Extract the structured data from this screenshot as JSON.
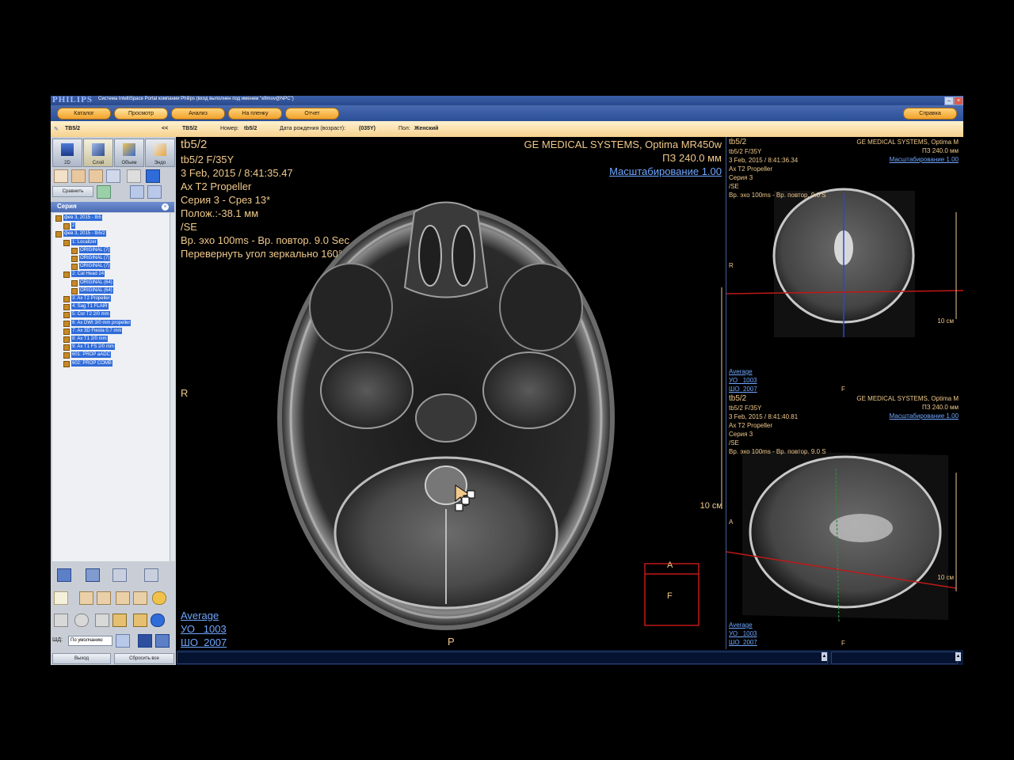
{
  "window": {
    "brand": "PHILIPS",
    "title": "Система IntelliSpace Portal компании Philips (вход выполнен под именем \"efimov@NPC\")",
    "help_label": "Справка"
  },
  "menu": [
    "Каталог",
    "Просмотр",
    "Анализ",
    "На пленку",
    "Отчет"
  ],
  "infobar": {
    "study_label": "TB5/2",
    "collapse": "<<",
    "patient_id": "TB5/2",
    "number_label": "Номер:",
    "number_value": "tb5/2",
    "dob_label": "Дата рождения (возраст):",
    "dob_value": "(035Y)",
    "sex_label": "Пол:",
    "sex_value": "Женский"
  },
  "left_panel": {
    "view_tools": [
      "2D",
      "Слой",
      "Объем",
      "Эндо"
    ],
    "compare_label": "Сравнить",
    "series_title": "Серия",
    "tree": [
      {
        "level": 0,
        "label": "фев 3, 2015 - tb5"
      },
      {
        "level": 1,
        "label": "2"
      },
      {
        "level": 0,
        "label": "фев 3, 2015 - tb5/2"
      },
      {
        "level": 1,
        "label": "1: Localizer"
      },
      {
        "level": 2,
        "label": "ORIGINAL (7)"
      },
      {
        "level": 2,
        "label": "ORIGINAL (7)"
      },
      {
        "level": 2,
        "label": "ORIGINAL (7)"
      },
      {
        "level": 1,
        "label": "2: Cal Head 24"
      },
      {
        "level": 2,
        "label": "ORIGINAL (64)"
      },
      {
        "level": 2,
        "label": "ORIGINAL (64)"
      },
      {
        "level": 1,
        "label": "3: Ax T2 Propeller"
      },
      {
        "level": 1,
        "label": "4: Sag T1 FLAIR"
      },
      {
        "level": 1,
        "label": "5: Cor T2 2/0 mm"
      },
      {
        "level": 1,
        "label": "6: Ax DWI 3/0 mm propeller"
      },
      {
        "level": 1,
        "label": "7: Ax 3D Fiesta 0.7 mm"
      },
      {
        "level": 1,
        "label": "8: Ax T1 2/0 mm"
      },
      {
        "level": 1,
        "label": "9: Ax T1 FS 2/0 mm"
      },
      {
        "level": 1,
        "label": "601: PROP aADC"
      },
      {
        "level": 1,
        "label": "602: PROP COMB"
      }
    ],
    "preset_label": "ШД:",
    "preset_value": "По умолчанию",
    "exit_label": "Выход",
    "reset_label": "Сбросить все"
  },
  "main_view": {
    "series_name": "tb5/2",
    "patient": "tb5/2 F/35Y",
    "datetime": "3 Feb, 2015 / 8:41:35.47",
    "protocol": "Ax T2 Propeller",
    "series_slice": "Серия 3 - Срез 13*",
    "position": "Полож.:-38.1 мм",
    "sequence": "/SE",
    "echo_repeat": "Вр. эхо 100ms - Вр. повтор. 9.0 Sec",
    "orientation_note": "Перевернуть угол зеркально 160°",
    "manufacturer": "GE MEDICAL SYSTEMS, Optima MR450w",
    "fov": "ПЗ 240.0 мм",
    "zoom": "Масштабирование 1.00",
    "left_marker": "R",
    "bottom_marker": "P",
    "scale_label": "10 см",
    "cube_top": "A",
    "cube_face": "F",
    "average": "Average",
    "wl": "УО   1003",
    "ww": "ШО  2007"
  },
  "coronal_view": {
    "series_name": "tb5/2",
    "patient": "tb5/2 F/35Y",
    "datetime": "3 Feb, 2015 / 8:41:36.34",
    "protocol": "Ax T2 Propeller",
    "series": "Серия 3",
    "sequence": "/SE",
    "echo_repeat": "Вр. эхо 100ms - Вр. повтор. 9.0 S",
    "manufacturer": "GE MEDICAL SYSTEMS, Optima M",
    "fov": "ПЗ 240.0 мм",
    "zoom": "Масштабирование 1.00",
    "left_marker": "R",
    "scale_label": "10 см",
    "average": "Average",
    "wl": "УО   1003",
    "ww": "ШО  2007",
    "bottom_marker": "F"
  },
  "sagittal_view": {
    "series_name": "tb5/2",
    "patient": "tb5/2 F/35Y",
    "datetime": "3 Feb, 2015 / 8:41:40.81",
    "protocol": "Ax T2 Propeller",
    "series": "Серия 3",
    "sequence": "/SE",
    "echo_repeat": "Вр. эхо 100ms - Вр. повтор. 9.0 S",
    "manufacturer": "GE MEDICAL SYSTEMS, Optima M",
    "fov": "ПЗ 240.0 мм",
    "zoom": "Масштабирование 1.00",
    "left_marker": "A",
    "scale_label": "10 см",
    "average": "Average",
    "wl": "УО   1003",
    "ww": "ШО  2007",
    "bottom_marker": "F"
  },
  "colors": {
    "overlay_text": "#f0c98a",
    "link_text": "#6fa6ff",
    "menu_button": "#f2a22c",
    "selection": "#2f6bd9",
    "crosshair": "#d01010"
  }
}
